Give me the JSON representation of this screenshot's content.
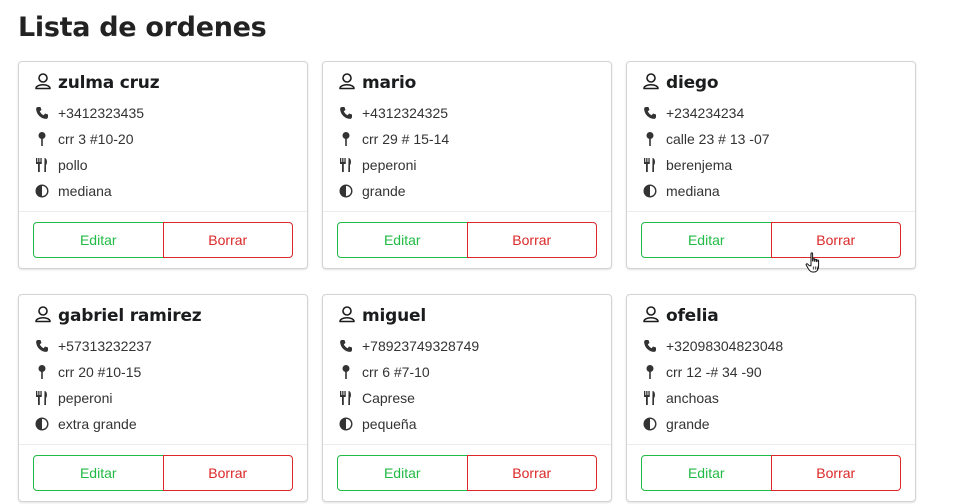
{
  "page": {
    "title": "Lista de ordenes"
  },
  "icons": {
    "name": "user-outline-icon",
    "phone": "phone-icon",
    "address": "map-pin-icon",
    "food": "utensils-icon",
    "size": "half-circle-icon"
  },
  "colors": {
    "edit": "#21ba45",
    "delete": "#db2828"
  },
  "orders": [
    {
      "name": "zulma cruz",
      "phone": "+3412323435",
      "address": "crr 3 #10-20",
      "food": "pollo",
      "size": "mediana",
      "edit_label": "Editar",
      "delete_label": "Borrar"
    },
    {
      "name": "mario",
      "phone": "+4312324325",
      "address": "crr 29 # 15-14",
      "food": "peperoni",
      "size": "grande",
      "edit_label": "Editar",
      "delete_label": "Borrar"
    },
    {
      "name": "diego",
      "phone": "+234234234",
      "address": "calle 23 # 13 -07",
      "food": "berenjema",
      "size": "mediana",
      "edit_label": "Editar",
      "delete_label": "Borrar"
    },
    {
      "name": "gabriel ramirez",
      "phone": "+57313232237",
      "address": "crr 20 #10-15",
      "food": "peperoni",
      "size": "extra grande",
      "edit_label": "Editar",
      "delete_label": "Borrar"
    },
    {
      "name": "miguel",
      "phone": "+78923749328749",
      "address": "crr 6 #7-10",
      "food": "Caprese",
      "size": "pequeña",
      "edit_label": "Editar",
      "delete_label": "Borrar"
    },
    {
      "name": "ofelia",
      "phone": "+32098304823048",
      "address": "crr 12 -# 34 -90",
      "food": "anchoas",
      "size": "grande",
      "edit_label": "Editar",
      "delete_label": "Borrar"
    }
  ]
}
